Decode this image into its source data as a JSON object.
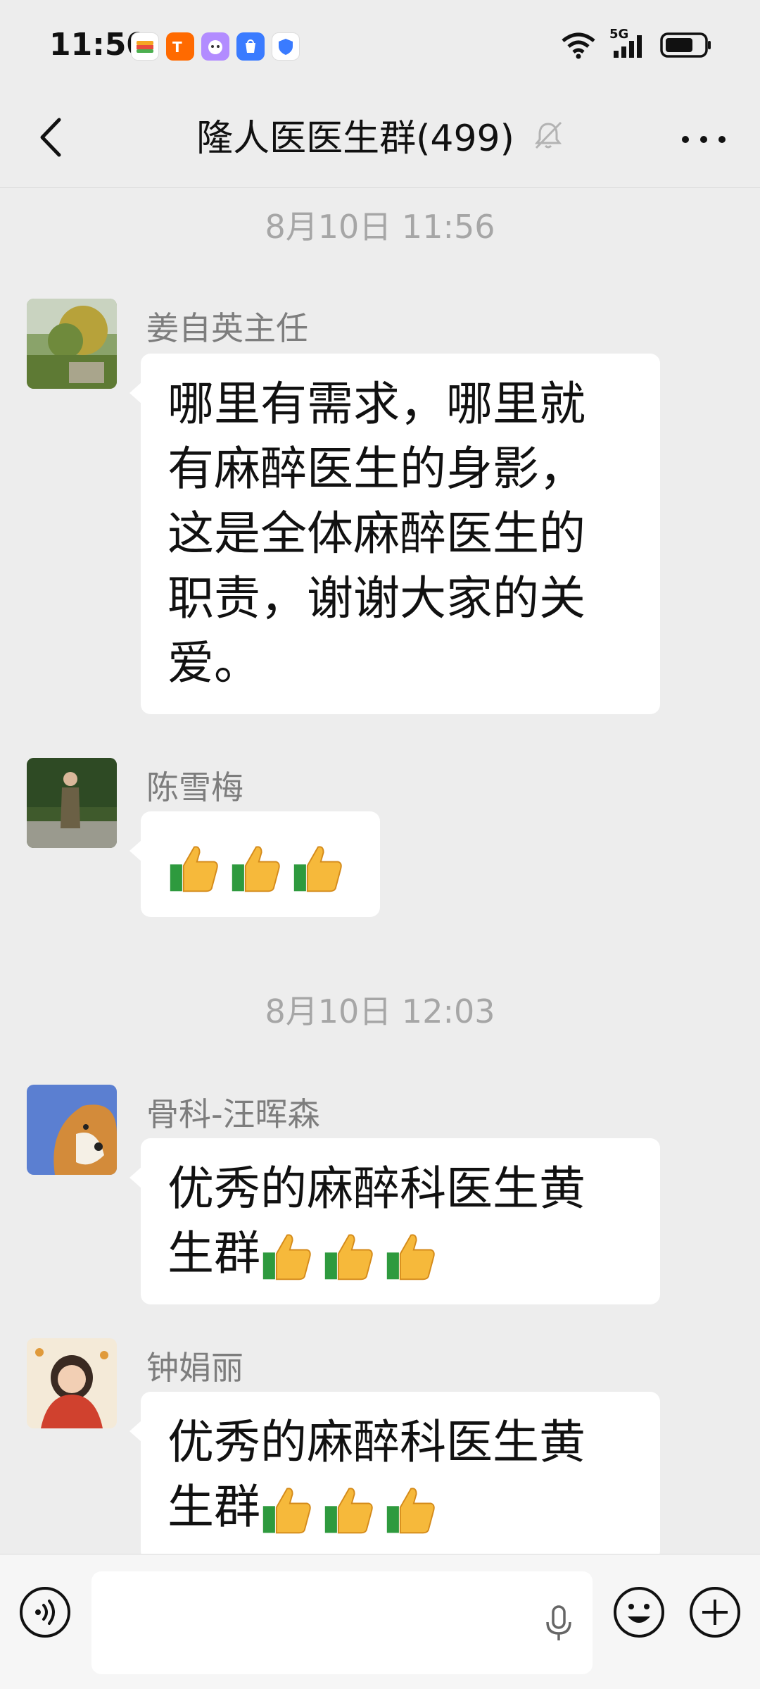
{
  "status_bar": {
    "time": "11:50",
    "network": "5G"
  },
  "header": {
    "title": "隆人医医生群(499)",
    "muted_icon": "bell-off-icon"
  },
  "messages_section": {
    "timestamps": [
      "8月10日 11:56",
      "8月10日 12:03"
    ]
  },
  "messages": [
    {
      "sender": "姜自英主任",
      "lines": [
        "哪里有需求，哪里就",
        "有麻醉医生的身影，",
        "这是全体麻醉医生的",
        "职责，谢谢大家的关",
        "爱。"
      ]
    },
    {
      "sender": "陈雪梅",
      "thumbs_count": 3
    },
    {
      "sender": "骨科-汪晖森",
      "lines": [
        "优秀的麻醉科医生黄",
        "生群"
      ],
      "thumbs_count": 3
    },
    {
      "sender": "钟娟丽",
      "lines": [
        "优秀的麻醉科医生黄",
        "生群"
      ],
      "thumbs_count": 3
    }
  ],
  "input_bar": {
    "voice_toggle_icon": "voice-icon",
    "mic_icon": "microphone-icon",
    "emoji_icon": "emoji-icon",
    "plus_icon": "plus-icon"
  },
  "colors": {
    "background": "#ededed",
    "bubble": "#ffffff",
    "secondary_text": "#7d7d7d",
    "timestamp_text": "#a6a6a6"
  }
}
